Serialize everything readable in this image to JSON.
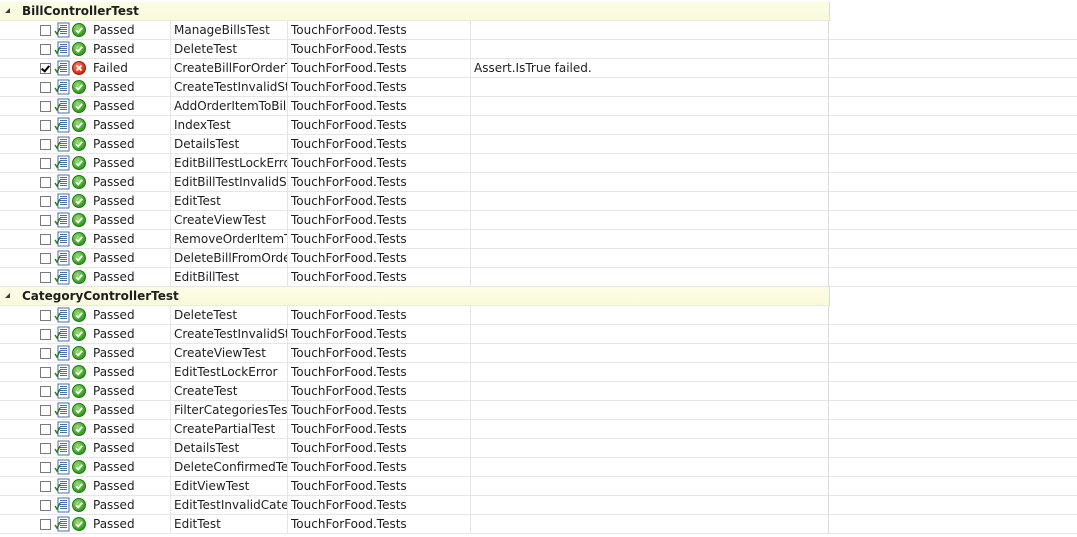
{
  "groups": [
    {
      "name": "BillControllerTest",
      "rows": [
        {
          "checked": false,
          "status": "pass",
          "result": "Passed",
          "name": "ManageBillsTest",
          "project": "TouchForFood.Tests",
          "error": ""
        },
        {
          "checked": false,
          "status": "pass",
          "result": "Passed",
          "name": "DeleteTest",
          "project": "TouchForFood.Tests",
          "error": ""
        },
        {
          "checked": true,
          "status": "fail",
          "result": "Failed",
          "name": "CreateBillForOrderTes",
          "project": "TouchForFood.Tests",
          "error": "Assert.IsTrue failed."
        },
        {
          "checked": false,
          "status": "pass",
          "result": "Passed",
          "name": "CreateTestInvalidState",
          "project": "TouchForFood.Tests",
          "error": ""
        },
        {
          "checked": false,
          "status": "pass",
          "result": "Passed",
          "name": "AddOrderItemToBillTest",
          "project": "TouchForFood.Tests",
          "error": ""
        },
        {
          "checked": false,
          "status": "pass",
          "result": "Passed",
          "name": "IndexTest",
          "project": "TouchForFood.Tests",
          "error": ""
        },
        {
          "checked": false,
          "status": "pass",
          "result": "Passed",
          "name": "DetailsTest",
          "project": "TouchForFood.Tests",
          "error": ""
        },
        {
          "checked": false,
          "status": "pass",
          "result": "Passed",
          "name": "EditBillTestLockError",
          "project": "TouchForFood.Tests",
          "error": ""
        },
        {
          "checked": false,
          "status": "pass",
          "result": "Passed",
          "name": "EditBillTestInvalidState",
          "project": "TouchForFood.Tests",
          "error": ""
        },
        {
          "checked": false,
          "status": "pass",
          "result": "Passed",
          "name": "EditTest",
          "project": "TouchForFood.Tests",
          "error": ""
        },
        {
          "checked": false,
          "status": "pass",
          "result": "Passed",
          "name": "CreateViewTest",
          "project": "TouchForFood.Tests",
          "error": ""
        },
        {
          "checked": false,
          "status": "pass",
          "result": "Passed",
          "name": "RemoveOrderItemTest",
          "project": "TouchForFood.Tests",
          "error": ""
        },
        {
          "checked": false,
          "status": "pass",
          "result": "Passed",
          "name": "DeleteBillFromOrderTest",
          "project": "TouchForFood.Tests",
          "error": ""
        },
        {
          "checked": false,
          "status": "pass",
          "result": "Passed",
          "name": "EditBillTest",
          "project": "TouchForFood.Tests",
          "error": ""
        }
      ]
    },
    {
      "name": "CategoryControllerTest",
      "rows": [
        {
          "checked": false,
          "status": "pass",
          "result": "Passed",
          "name": "DeleteTest",
          "project": "TouchForFood.Tests",
          "error": ""
        },
        {
          "checked": false,
          "status": "pass",
          "result": "Passed",
          "name": "CreateTestInvalidState",
          "project": "TouchForFood.Tests",
          "error": ""
        },
        {
          "checked": false,
          "status": "pass",
          "result": "Passed",
          "name": "CreateViewTest",
          "project": "TouchForFood.Tests",
          "error": ""
        },
        {
          "checked": false,
          "status": "pass",
          "result": "Passed",
          "name": "EditTestLockError",
          "project": "TouchForFood.Tests",
          "error": ""
        },
        {
          "checked": false,
          "status": "pass",
          "result": "Passed",
          "name": "CreateTest",
          "project": "TouchForFood.Tests",
          "error": ""
        },
        {
          "checked": false,
          "status": "pass",
          "result": "Passed",
          "name": "FilterCategoriesTest",
          "project": "TouchForFood.Tests",
          "error": ""
        },
        {
          "checked": false,
          "status": "pass",
          "result": "Passed",
          "name": "CreatePartialTest",
          "project": "TouchForFood.Tests",
          "error": ""
        },
        {
          "checked": false,
          "status": "pass",
          "result": "Passed",
          "name": "DetailsTest",
          "project": "TouchForFood.Tests",
          "error": ""
        },
        {
          "checked": false,
          "status": "pass",
          "result": "Passed",
          "name": "DeleteConfirmedTest",
          "project": "TouchForFood.Tests",
          "error": ""
        },
        {
          "checked": false,
          "status": "pass",
          "result": "Passed",
          "name": "EditViewTest",
          "project": "TouchForFood.Tests",
          "error": ""
        },
        {
          "checked": false,
          "status": "pass",
          "result": "Passed",
          "name": "EditTestInvalidCategory",
          "project": "TouchForFood.Tests",
          "error": ""
        },
        {
          "checked": false,
          "status": "pass",
          "result": "Passed",
          "name": "EditTest",
          "project": "TouchForFood.Tests",
          "error": ""
        }
      ]
    }
  ],
  "icons": {
    "expander": "collapse-triangle-icon",
    "test": "test-document-icon",
    "pass": "passed-check-icon",
    "fail": "failed-x-icon"
  },
  "colors": {
    "group_background": "#fdfde6",
    "pass": "#2f9d1c",
    "fail": "#d22b10",
    "gridline": "#e6e6e6"
  }
}
